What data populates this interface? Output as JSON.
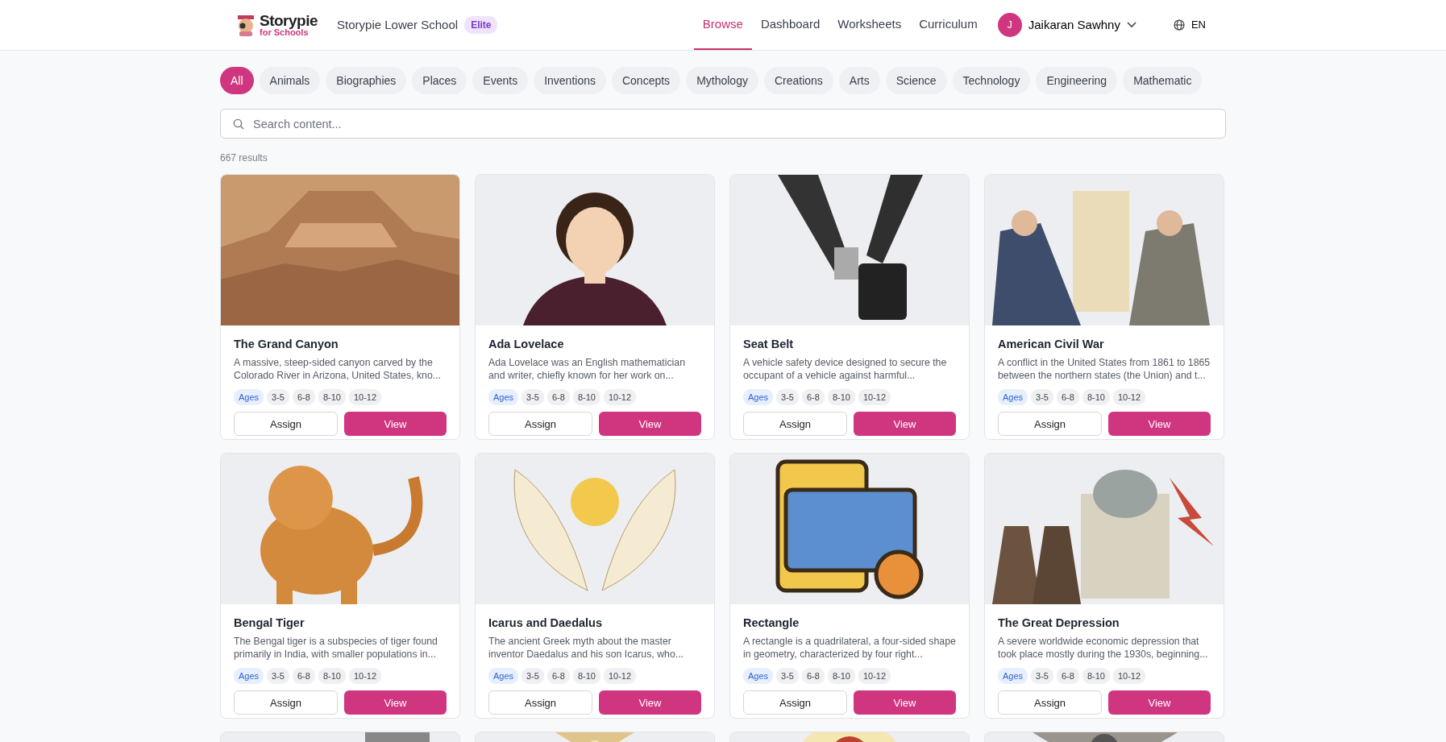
{
  "header": {
    "logo": {
      "name": "Storypie",
      "sub": "for Schools"
    },
    "school": "Storypie Lower School",
    "plan": "Elite",
    "nav": [
      {
        "label": "Browse",
        "selected": true
      },
      {
        "label": "Dashboard",
        "selected": false
      },
      {
        "label": "Worksheets",
        "selected": false
      },
      {
        "label": "Curriculum",
        "selected": false
      }
    ],
    "user": {
      "initial": "J",
      "name": "Jaikaran Sawhny"
    },
    "language": "EN"
  },
  "categories": [
    {
      "label": "All",
      "selected": true
    },
    {
      "label": "Animals",
      "selected": false
    },
    {
      "label": "Biographies",
      "selected": false
    },
    {
      "label": "Places",
      "selected": false
    },
    {
      "label": "Events",
      "selected": false
    },
    {
      "label": "Inventions",
      "selected": false
    },
    {
      "label": "Concepts",
      "selected": false
    },
    {
      "label": "Mythology",
      "selected": false
    },
    {
      "label": "Creations",
      "selected": false
    },
    {
      "label": "Arts",
      "selected": false
    },
    {
      "label": "Science",
      "selected": false
    },
    {
      "label": "Technology",
      "selected": false
    },
    {
      "label": "Engineering",
      "selected": false
    },
    {
      "label": "Mathematic",
      "selected": false
    }
  ],
  "search": {
    "placeholder": "Search content..."
  },
  "result_count": "667 results",
  "cards": [
    {
      "kind": "full",
      "title": "The Grand Canyon",
      "description": "A massive, steep-sided canyon carved by the Colorado River in Arizona, United States, kno...",
      "ages_label": "Ages",
      "ages": [
        "3-5",
        "6-8",
        "8-10",
        "10-12"
      ],
      "buttons": [
        "Assign",
        "View"
      ]
    },
    {
      "kind": "full",
      "title": "Ada Lovelace",
      "description": "Ada Lovelace was an English mathematician and writer, chiefly known for her work on...",
      "ages_label": "Ages",
      "ages": [
        "3-5",
        "6-8",
        "8-10",
        "10-12"
      ],
      "buttons": [
        "Assign",
        "View"
      ]
    },
    {
      "kind": "full",
      "title": "Seat Belt",
      "description": "A vehicle safety device designed to secure the occupant of a vehicle against harmful...",
      "ages_label": "Ages",
      "ages": [
        "3-5",
        "6-8",
        "8-10",
        "10-12"
      ],
      "buttons": [
        "Assign",
        "View"
      ]
    },
    {
      "kind": "full",
      "title": "American Civil War",
      "description": "A conflict in the United States from 1861 to 1865 between the northern states (the Union) and t...",
      "ages_label": "Ages",
      "ages": [
        "3-5",
        "6-8",
        "8-10",
        "10-12"
      ],
      "buttons": [
        "Assign",
        "View"
      ]
    },
    {
      "kind": "full",
      "title": "Bengal Tiger",
      "description": "The Bengal tiger is a subspecies of tiger found primarily in India, with smaller populations in...",
      "ages_label": "Ages",
      "ages": [
        "3-5",
        "6-8",
        "8-10",
        "10-12"
      ],
      "buttons": [
        "Assign",
        "View"
      ]
    },
    {
      "kind": "full",
      "title": "Icarus and Daedalus",
      "description": "The ancient Greek myth about the master inventor Daedalus and his son Icarus, who...",
      "ages_label": "Ages",
      "ages": [
        "3-5",
        "6-8",
        "8-10",
        "10-12"
      ],
      "buttons": [
        "Assign",
        "View"
      ]
    },
    {
      "kind": "full",
      "title": "Rectangle",
      "description": "A rectangle is a quadrilateral, a four-sided shape in geometry, characterized by four right...",
      "ages_label": "Ages",
      "ages": [
        "3-5",
        "6-8",
        "8-10",
        "10-12"
      ],
      "buttons": [
        "Assign",
        "View"
      ]
    },
    {
      "kind": "full",
      "title": "The Great Depression",
      "description": "A severe worldwide economic depression that took place mostly during the 1930s, beginning...",
      "ages_label": "Ages",
      "ages": [
        "3-5",
        "6-8",
        "8-10",
        "10-12"
      ],
      "buttons": [
        "Assign",
        "View"
      ]
    },
    {
      "kind": "picture"
    },
    {
      "kind": "picture"
    },
    {
      "kind": "picture"
    },
    {
      "kind": "picture"
    }
  ]
}
